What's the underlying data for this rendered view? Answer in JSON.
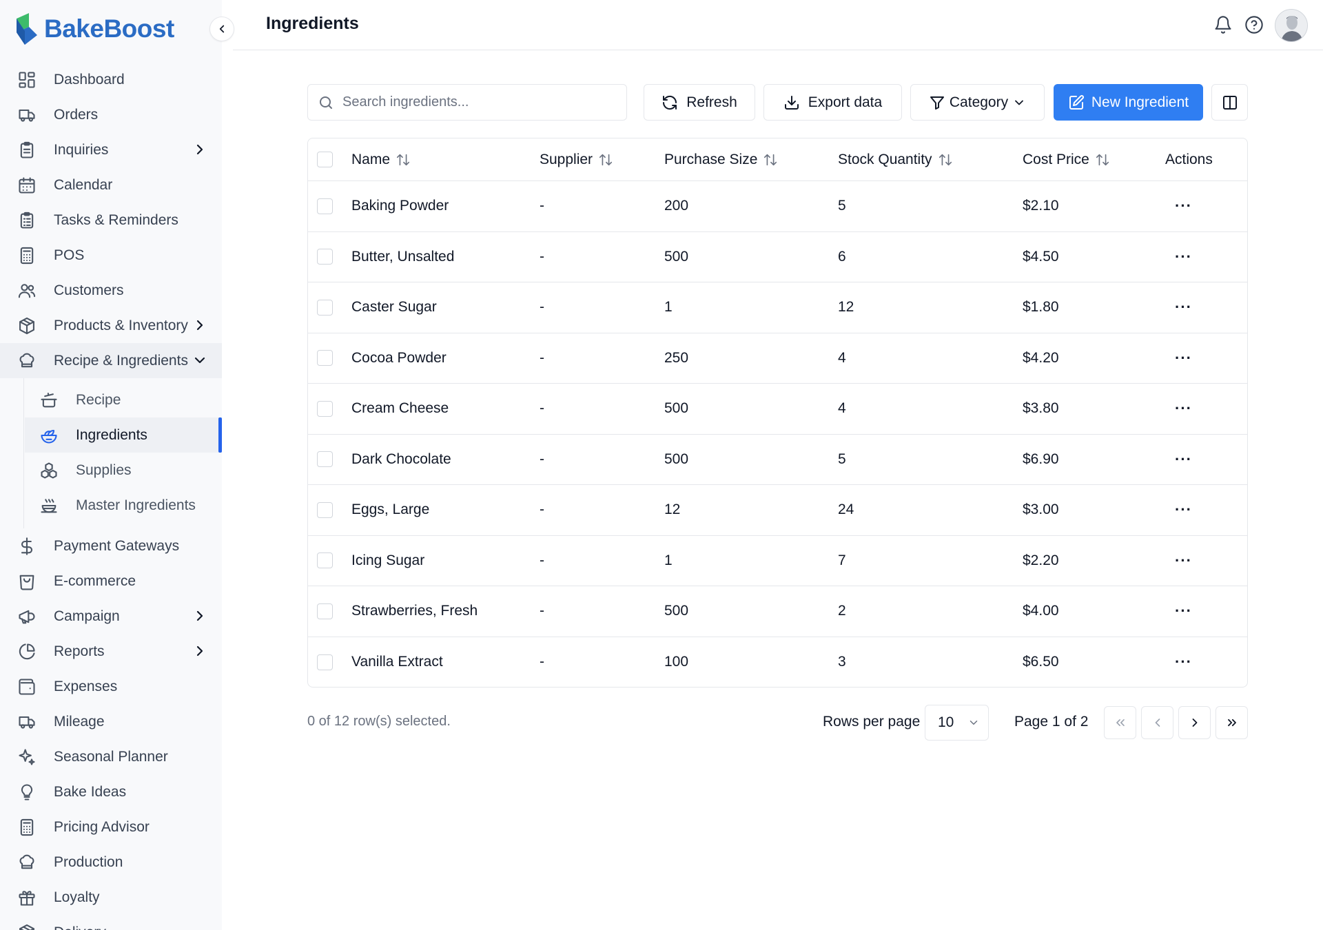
{
  "brand": {
    "name": "BakeBoost",
    "color": "#2b6cc4"
  },
  "header": {
    "title": "Ingredients"
  },
  "sidebar": {
    "items": [
      {
        "label": "Dashboard",
        "icon": "dashboard-icon"
      },
      {
        "label": "Orders",
        "icon": "truck-icon"
      },
      {
        "label": "Inquiries",
        "icon": "clipboard-icon",
        "has_children": true
      },
      {
        "label": "Calendar",
        "icon": "calendar-icon"
      },
      {
        "label": "Tasks & Reminders",
        "icon": "clipboard-list-icon"
      },
      {
        "label": "POS",
        "icon": "calculator-icon"
      },
      {
        "label": "Customers",
        "icon": "users-icon"
      },
      {
        "label": "Products & Inventory",
        "icon": "package-icon",
        "has_children": true
      },
      {
        "label": "Recipe & Ingredients",
        "icon": "chef-hat-icon",
        "expanded": true
      }
    ],
    "subitems": [
      {
        "label": "Recipe",
        "icon": "cooking-pot-icon"
      },
      {
        "label": "Ingredients",
        "icon": "salad-icon",
        "active": true
      },
      {
        "label": "Supplies",
        "icon": "boxes-icon"
      },
      {
        "label": "Master Ingredients",
        "icon": "soup-icon"
      }
    ],
    "items_after": [
      {
        "label": "Payment Gateways",
        "icon": "dollar-icon"
      },
      {
        "label": "E-commerce",
        "icon": "shopping-bag-icon"
      },
      {
        "label": "Campaign",
        "icon": "megaphone-icon",
        "has_children": true
      },
      {
        "label": "Reports",
        "icon": "pie-chart-icon",
        "has_children": true
      },
      {
        "label": "Expenses",
        "icon": "wallet-icon"
      },
      {
        "label": "Mileage",
        "icon": "truck-icon"
      },
      {
        "label": "Seasonal Planner",
        "icon": "sparkles-icon"
      },
      {
        "label": "Bake Ideas",
        "icon": "lightbulb-icon"
      },
      {
        "label": "Pricing Advisor",
        "icon": "calculator-icon"
      },
      {
        "label": "Production",
        "icon": "chef-hat-icon"
      },
      {
        "label": "Loyalty",
        "icon": "gift-icon"
      },
      {
        "label": "Delivery",
        "icon": "package-icon"
      }
    ]
  },
  "toolbar": {
    "search_placeholder": "Search ingredients...",
    "refresh_label": "Refresh",
    "export_label": "Export data",
    "category_label": "Category",
    "new_label": "New Ingredient",
    "accent": "#2f7ef2"
  },
  "table": {
    "columns": [
      "Name",
      "Supplier",
      "Purchase Size",
      "Stock Quantity",
      "Cost Price",
      "Actions"
    ],
    "rows": [
      {
        "name": "Baking Powder",
        "supplier": "-",
        "purchase_size": "200",
        "stock": "5",
        "cost": "$2.10",
        "actions": "···"
      },
      {
        "name": "Butter, Unsalted",
        "supplier": "-",
        "purchase_size": "500",
        "stock": "6",
        "cost": "$4.50",
        "actions": "···"
      },
      {
        "name": "Caster Sugar",
        "supplier": "-",
        "purchase_size": "1",
        "stock": "12",
        "cost": "$1.80",
        "actions": "···"
      },
      {
        "name": "Cocoa Powder",
        "supplier": "-",
        "purchase_size": "250",
        "stock": "4",
        "cost": "$4.20",
        "actions": "···"
      },
      {
        "name": "Cream Cheese",
        "supplier": "-",
        "purchase_size": "500",
        "stock": "4",
        "cost": "$3.80",
        "actions": "···"
      },
      {
        "name": "Dark Chocolate",
        "supplier": "-",
        "purchase_size": "500",
        "stock": "5",
        "cost": "$6.90",
        "actions": "···"
      },
      {
        "name": "Eggs, Large",
        "supplier": "-",
        "purchase_size": "12",
        "stock": "24",
        "cost": "$3.00",
        "actions": "···"
      },
      {
        "name": "Icing Sugar",
        "supplier": "-",
        "purchase_size": "1",
        "stock": "7",
        "cost": "$2.20",
        "actions": "···"
      },
      {
        "name": "Strawberries, Fresh",
        "supplier": "-",
        "purchase_size": "500",
        "stock": "2",
        "cost": "$4.00",
        "actions": "···"
      },
      {
        "name": "Vanilla Extract",
        "supplier": "-",
        "purchase_size": "100",
        "stock": "3",
        "cost": "$6.50",
        "actions": "···"
      }
    ]
  },
  "footer": {
    "selection_text": "0 of 12 row(s) selected.",
    "rows_per_page_label": "Rows per page",
    "rows_per_page_value": "10",
    "page_info": "Page 1 of 2"
  }
}
